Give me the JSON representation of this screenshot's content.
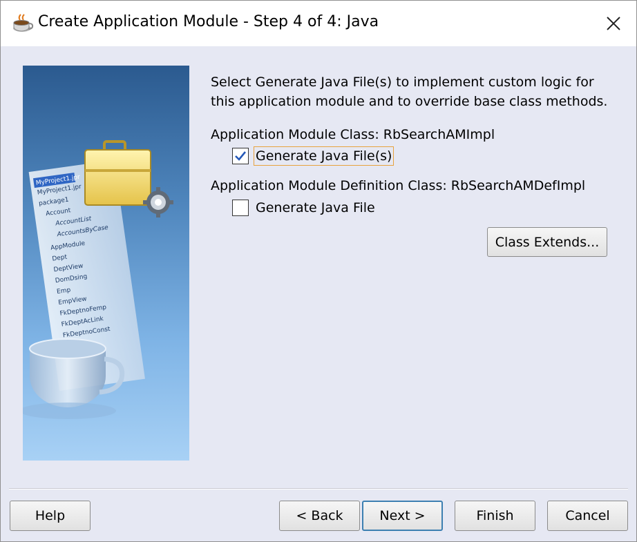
{
  "window": {
    "title": "Create Application Module - Step 4 of 4: Java"
  },
  "intro": {
    "line1": "Select Generate Java File(s) to implement custom logic for",
    "line2": "this application module and to override base class methods."
  },
  "am_class": {
    "label": "Application Module Class: RbSearchAMImpl",
    "checkbox_label": "Generate Java File(s)",
    "checked": true
  },
  "am_def_class": {
    "label": "Application Module Definition Class: RbSearchAMDefImpl",
    "checkbox_label": "Generate Java File",
    "checked": false
  },
  "buttons": {
    "class_extends": "Class Extends...",
    "help": "Help",
    "back": "< Back",
    "next": "Next >",
    "finish": "Finish",
    "cancel": "Cancel"
  },
  "banner": {
    "tree_items": [
      "MyProject1.jpr",
      "MyProject1.jpr",
      "package1",
      "Account",
      "AccountList",
      "AccountsByCase",
      "AppModule",
      "Dept",
      "DeptView",
      "DomDsing",
      "Emp",
      "EmpView",
      "FkDeptnoFemp",
      "FkDeptAcLink",
      "FkDeptnoConst"
    ]
  },
  "colors": {
    "banner_top": "#2b5a8f",
    "banner_bottom": "#a8d1f5",
    "default_button_border": "#3c7fb1",
    "focus_outline": "#e8a23c"
  }
}
